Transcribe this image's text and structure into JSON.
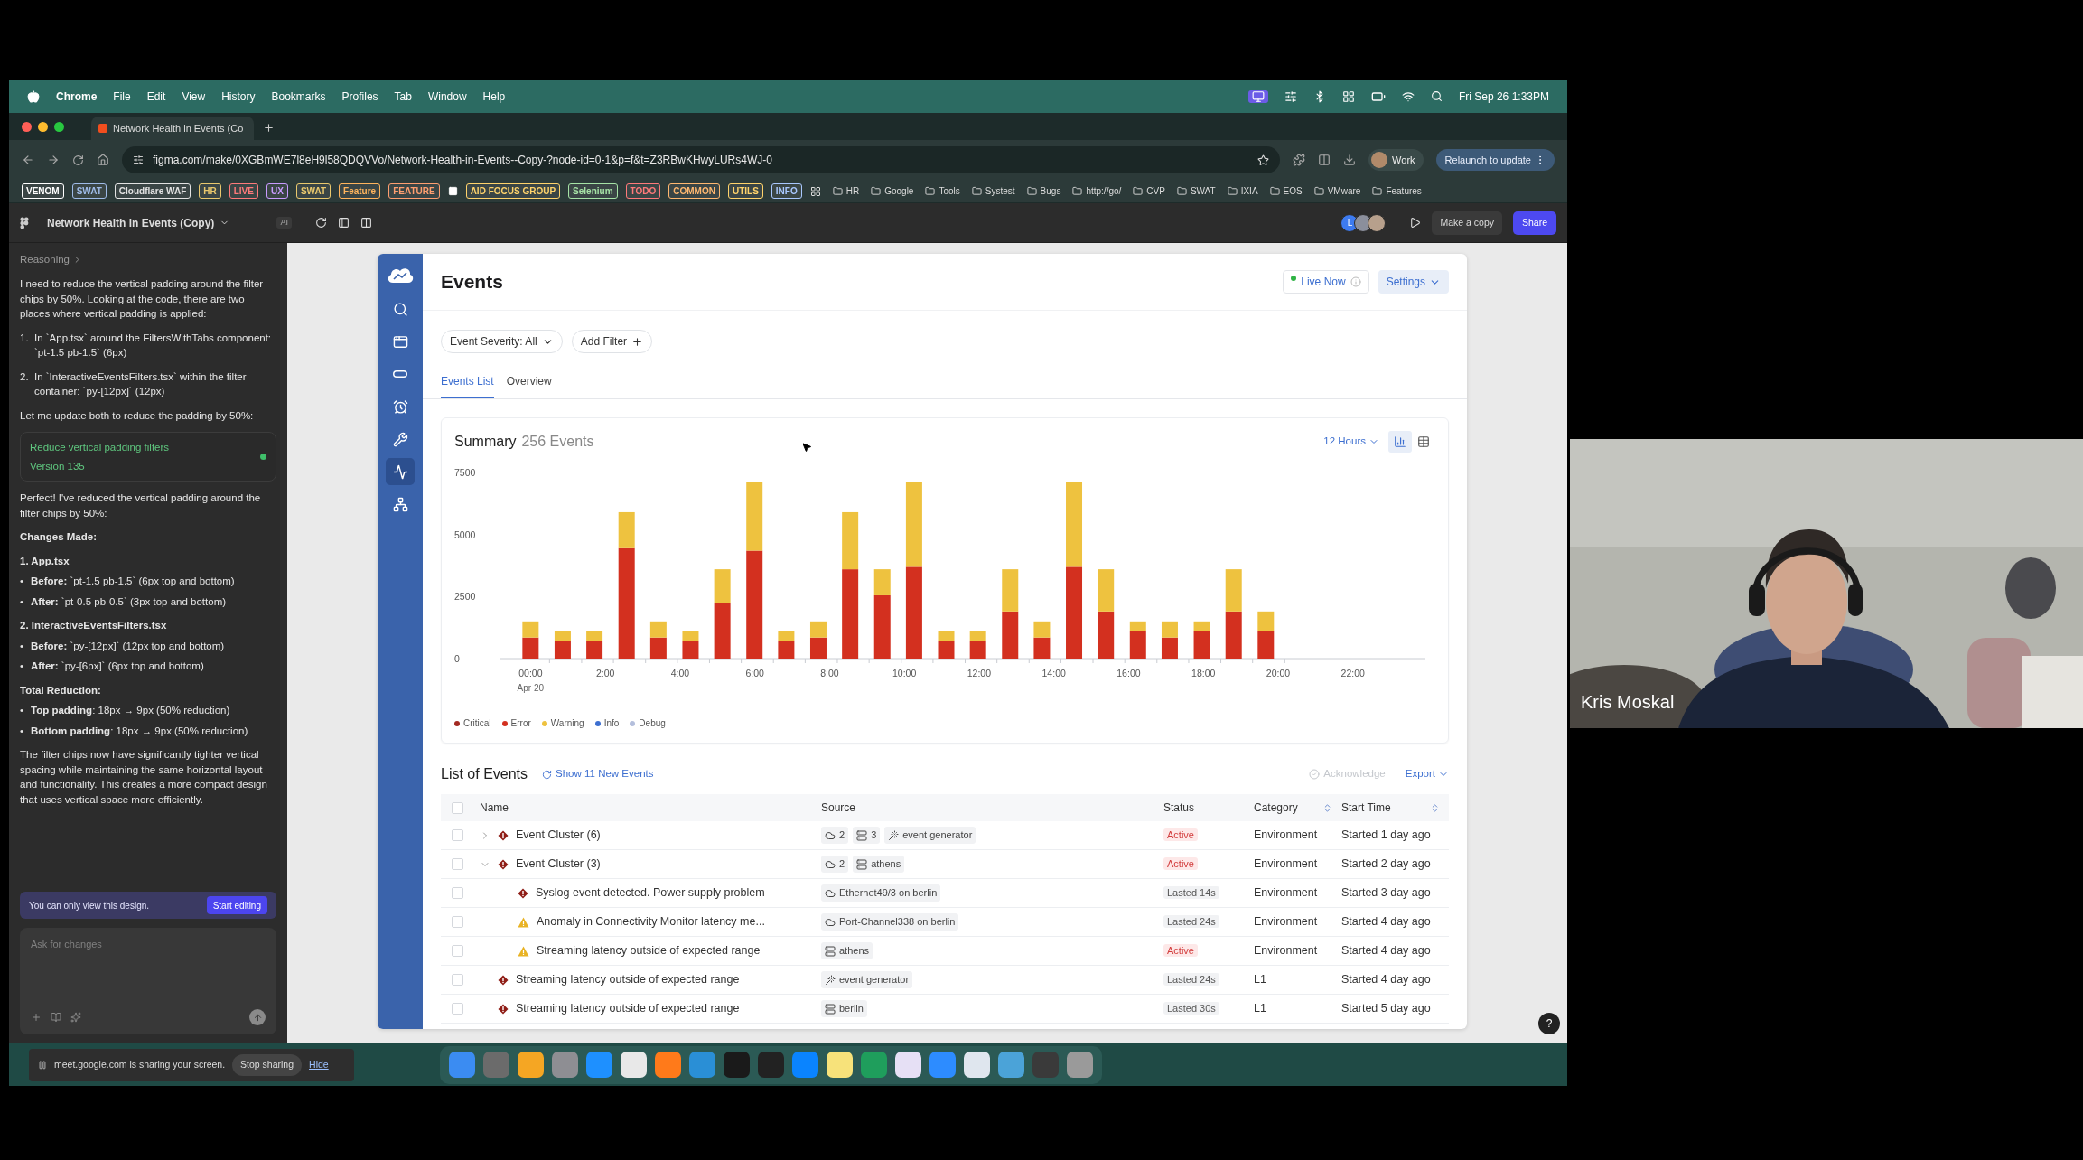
{
  "menubar": {
    "app": "Chrome",
    "items": [
      "File",
      "Edit",
      "View",
      "History",
      "Bookmarks",
      "Profiles",
      "Tab",
      "Window",
      "Help"
    ],
    "clock": "Fri Sep 26 1:33PM"
  },
  "browser": {
    "tab": {
      "title": "Network Health in Events (Co",
      "selected": true
    },
    "url": "figma.com/make/0XGBmWE7l8eH9l58QDQVVo/Network-Health-in-Events--Copy-?node-id=0-1&p=f&t=Z3RBwKHwyLURs4WJ-0",
    "profile": "Work",
    "relaunch": "Relaunch to update",
    "bookmark_tags": [
      {
        "label": "VENOM",
        "color": "#ffffff"
      },
      {
        "label": "SWAT",
        "color": "#9fbbe8"
      },
      {
        "label": "Cloudflare WAF",
        "color": "#e2e2e2"
      },
      {
        "label": "HR",
        "color": "#e9c86d"
      },
      {
        "label": "LIVE",
        "color": "#ff7a7a"
      },
      {
        "label": "UX",
        "color": "#c99bff"
      },
      {
        "label": "SWAT",
        "color": "#e9c86d"
      },
      {
        "label": "Feature",
        "color": "#ffb45c"
      },
      {
        "label": "FEATURE",
        "color": "#ff9f70"
      }
    ],
    "bookmark_tags_2": [
      {
        "label": "AID FOCUS GROUP",
        "color": "#ffd36b"
      },
      {
        "label": "Selenium",
        "color": "#a6e3a6"
      },
      {
        "label": "TODO",
        "color": "#ff7a7a"
      },
      {
        "label": "COMMON",
        "color": "#ffb870"
      },
      {
        "label": "UTILS",
        "color": "#ffd36b"
      },
      {
        "label": "INFO",
        "color": "#a9c8ff"
      }
    ],
    "bookmark_folders": [
      "HR",
      "Google",
      "Tools",
      "Systest",
      "Bugs",
      "http://go/",
      "CVP",
      "SWAT",
      "IXIA",
      "EOS",
      "VMware",
      "Features"
    ]
  },
  "figma": {
    "file_title": "Network Health in Events (Copy)",
    "ai_badge": "AI",
    "avatar_letter": "L",
    "make_copy": "Make a copy",
    "share": "Share"
  },
  "chat": {
    "reasoning": "Reasoning",
    "blocks": [
      {
        "kind": "paragraph",
        "text": "I need to reduce the vertical padding around the filter chips by 50%. Looking at the code, there are two places where vertical padding is applied:"
      },
      {
        "kind": "list_item",
        "marker": "1.",
        "text": "In `App.tsx` around the FiltersWithTabs component: `pt-1.5 pb-1.5` (6px)"
      },
      {
        "kind": "list_item",
        "marker": "2.",
        "text": "In `InteractiveEventsFilters.tsx` within the filter container: `py-[12px]` (12px)"
      },
      {
        "kind": "paragraph",
        "text": "Let me update both to reduce the padding by 50%:"
      },
      {
        "kind": "version_card",
        "title": "Reduce vertical padding filters",
        "version": "Version 135",
        "color": "#3fbf6a"
      },
      {
        "kind": "paragraph",
        "text": "Perfect! I've reduced the vertical padding around the filter chips by 50%:"
      },
      {
        "kind": "heading",
        "text": "Changes Made:"
      },
      {
        "kind": "heading",
        "text": "1. App.tsx"
      },
      {
        "kind": "bullet",
        "marker": "•",
        "text": "**Before:** `pt-1.5 pb-1.5` (6px top and bottom)"
      },
      {
        "kind": "bullet",
        "marker": "•",
        "text": "**After:** `pt-0.5 pb-0.5` (3px top and bottom)"
      },
      {
        "kind": "heading",
        "text": "2. InteractiveEventsFilters.tsx"
      },
      {
        "kind": "bullet",
        "marker": "•",
        "text": "**Before:** `py-[12px]` (12px top and bottom)"
      },
      {
        "kind": "bullet",
        "marker": "•",
        "text": "**After:** `py-[6px]` (6px top and bottom)"
      },
      {
        "kind": "heading",
        "text": "Total Reduction:"
      },
      {
        "kind": "bullet",
        "marker": "•",
        "text": "**Top padding**: 18px → 9px (50% reduction)"
      },
      {
        "kind": "bullet",
        "marker": "•",
        "text": "**Bottom padding**: 18px → 9px (50% reduction)"
      },
      {
        "kind": "paragraph",
        "text": "The filter chips now have significantly tighter vertical spacing while maintaining the same horizontal layout and functionality. This creates a more compact design that uses vertical space more efficiently."
      }
    ],
    "view_only": "You can only view this design.",
    "start_editing": "Start editing",
    "input": {
      "placeholder": "Ask for changes"
    }
  },
  "app": {
    "nav": [
      {
        "selected": false
      },
      {
        "selected": false
      },
      {
        "selected": false
      },
      {
        "selected": false
      },
      {
        "selected": false
      },
      {
        "selected": true
      },
      {
        "selected": false
      }
    ],
    "title": "Events",
    "live": "Live Now",
    "settings": "Settings",
    "filters": [
      {
        "label": "Event Severity: All",
        "kind": "dropdown"
      },
      {
        "label": "Add Filter",
        "kind": "add"
      }
    ],
    "tabs": [
      {
        "label": "Events List",
        "selected": true
      },
      {
        "label": "Overview",
        "selected": false
      }
    ],
    "summary": {
      "title": "Summary",
      "count": "256 Events",
      "range": "12 Hours",
      "view_toggle": [
        {
          "selected": true
        },
        {
          "selected": false
        }
      ],
      "date_label": "Apr 20",
      "chart_data": {
        "type": "bar",
        "stacked": true,
        "x": [
          0,
          0.86,
          1.71,
          2.57,
          3.42,
          4.28,
          5.13,
          5.99,
          6.84,
          7.7,
          8.55,
          9.41,
          10.26,
          11.12,
          11.97,
          12.83,
          13.68,
          14.54,
          15.39,
          16.25,
          17.1,
          17.96,
          18.81,
          19.67
        ],
        "xlim": [
          -0.83,
          23.94
        ],
        "ylim": [
          0,
          7500
        ],
        "yticks": [
          0,
          2500,
          5000,
          7500
        ],
        "xticks": [
          {
            "value": 0,
            "label": "00:00"
          },
          {
            "value": 2,
            "label": "2:00"
          },
          {
            "value": 4,
            "label": "4:00"
          },
          {
            "value": 6,
            "label": "6:00"
          },
          {
            "value": 8,
            "label": "8:00"
          },
          {
            "value": 10,
            "label": "10:00"
          },
          {
            "value": 12,
            "label": "12:00"
          },
          {
            "value": 14,
            "label": "14:00"
          },
          {
            "value": 16,
            "label": "16:00"
          },
          {
            "value": 18,
            "label": "18:00"
          },
          {
            "value": 20,
            "label": "20:00"
          },
          {
            "value": 22,
            "label": "22:00"
          }
        ],
        "series": [
          {
            "name": "Critical",
            "color": "#a32a22",
            "values": [
              0,
              0,
              0,
              0,
              0,
              0,
              0,
              0,
              0,
              0,
              0,
              0,
              0,
              0,
              0,
              0,
              0,
              0,
              0,
              0,
              0,
              0,
              0,
              0
            ]
          },
          {
            "name": "Error",
            "color": "#d3301f",
            "values": [
              850,
              700,
              700,
              4450,
              850,
              700,
              2250,
              4350,
              700,
              850,
              3600,
              2550,
              3700,
              700,
              700,
              1900,
              850,
              3700,
              1900,
              1100,
              850,
              1100,
              1900,
              1100
            ]
          },
          {
            "name": "Warning",
            "color": "#eec23f",
            "values": [
              650,
              400,
              400,
              1450,
              650,
              400,
              1350,
              2750,
              400,
              650,
              2300,
              1050,
              3400,
              400,
              400,
              1700,
              650,
              3400,
              1700,
              400,
              650,
              400,
              1700,
              800
            ]
          },
          {
            "name": "Info",
            "color": "#3d6fd0",
            "values": [
              0,
              0,
              0,
              0,
              0,
              0,
              0,
              0,
              0,
              0,
              0,
              0,
              0,
              0,
              0,
              0,
              0,
              0,
              0,
              0,
              0,
              0,
              0,
              0
            ]
          },
          {
            "name": "Debug",
            "color": "#b4bfdc",
            "values": [
              0,
              0,
              0,
              0,
              0,
              0,
              0,
              0,
              0,
              0,
              0,
              0,
              0,
              0,
              0,
              0,
              0,
              0,
              0,
              0,
              0,
              0,
              0,
              0
            ]
          }
        ]
      }
    },
    "list": {
      "title": "List of Events",
      "new_events": "Show 11 New Events",
      "acknowledge": {
        "label": "Acknowledge",
        "disabled": true
      },
      "export": "Export",
      "columns": [
        {
          "label": "Name",
          "sortable": false
        },
        {
          "label": "Source",
          "sortable": false
        },
        {
          "label": "Status",
          "sortable": false
        },
        {
          "label": "Category",
          "sortable": true
        },
        {
          "label": "Start Time",
          "sortable": true
        }
      ],
      "select_all_checked": false,
      "rows": [
        {
          "checked": false,
          "expanded": false,
          "kind": "critical",
          "name": "Event Cluster (6)",
          "sources": [
            {
              "kind": "cloud",
              "text": "2"
            },
            {
              "kind": "server",
              "text": "3"
            },
            {
              "kind": "generator",
              "text": "event generator"
            }
          ],
          "status": {
            "kind": "active",
            "text": "Active"
          },
          "category": "Environment",
          "start": "Started 1 day ago"
        },
        {
          "checked": false,
          "expanded": true,
          "kind": "critical",
          "name": "Event Cluster (3)",
          "sources": [
            {
              "kind": "cloud",
              "text": "2"
            },
            {
              "kind": "server",
              "text": "athens"
            }
          ],
          "status": {
            "kind": "active",
            "text": "Active"
          },
          "category": "Environment",
          "start": "Started 2 day ago",
          "children": [
            {
              "checked": false,
              "kind": "critical",
              "name": "Syslog event detected. Power supply problem",
              "sources": [
                {
                  "kind": "cloud",
                  "text": "Ethernet49/3 on berlin"
                }
              ],
              "status": {
                "kind": "lasted",
                "text": "Lasted 14s"
              },
              "category": "Environment",
              "start": "Started 3 day ago"
            },
            {
              "checked": false,
              "kind": "warning",
              "name": "Anomaly in Connectivity Monitor latency me...",
              "sources": [
                {
                  "kind": "cloud",
                  "text": "Port-Channel338 on berlin"
                }
              ],
              "status": {
                "kind": "lasted",
                "text": "Lasted 24s"
              },
              "category": "Environment",
              "start": "Started 4 day ago"
            },
            {
              "checked": false,
              "kind": "warning",
              "name": "Streaming latency outside of expected range",
              "sources": [
                {
                  "kind": "server",
                  "text": "athens"
                }
              ],
              "status": {
                "kind": "active",
                "text": "Active"
              },
              "category": "Environment",
              "start": "Started 4 day ago"
            }
          ]
        },
        {
          "checked": false,
          "kind": "critical",
          "name": "Streaming latency outside of expected range",
          "sources": [
            {
              "kind": "generator",
              "text": "event generator"
            }
          ],
          "status": {
            "kind": "lasted",
            "text": "Lasted 24s"
          },
          "category": "L1",
          "start": "Started 4 day ago"
        },
        {
          "checked": false,
          "kind": "critical",
          "name": "Streaming latency outside of expected range",
          "sources": [
            {
              "kind": "server",
              "text": "berlin"
            }
          ],
          "status": {
            "kind": "lasted",
            "text": "Lasted 30s"
          },
          "category": "L1",
          "start": "Started 5 day ago"
        }
      ]
    }
  },
  "help": "?",
  "sharing": {
    "message": "meet.google.com is sharing your screen.",
    "stop": "Stop sharing",
    "hide": "Hide"
  },
  "video": {
    "kind": "picture",
    "name": "Kris Moskal"
  }
}
